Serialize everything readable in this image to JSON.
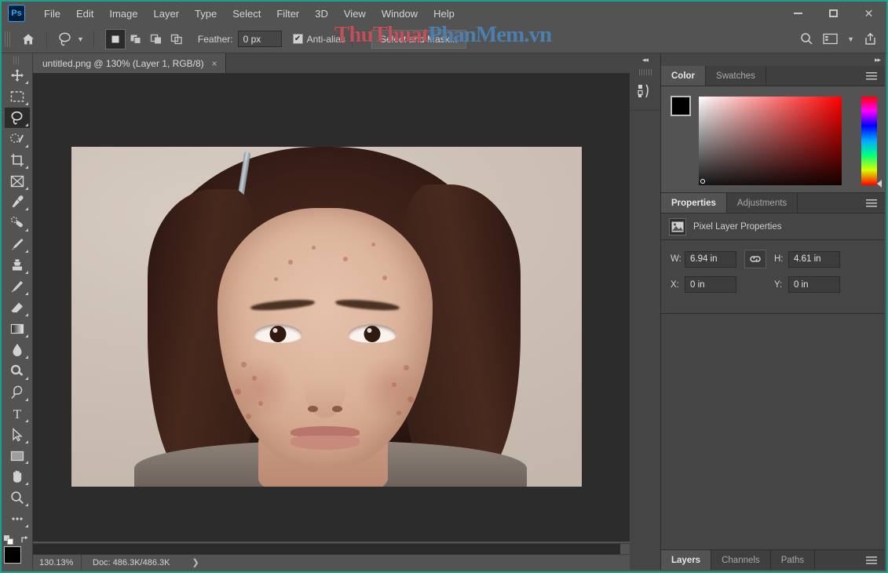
{
  "window": {
    "app_logo": "Ps",
    "minimize": "minimize-button",
    "maximize": "maximize-button",
    "close": "✕"
  },
  "menubar": {
    "items": [
      {
        "label": "File"
      },
      {
        "label": "Edit"
      },
      {
        "label": "Image"
      },
      {
        "label": "Layer"
      },
      {
        "label": "Type"
      },
      {
        "label": "Select"
      },
      {
        "label": "Filter"
      },
      {
        "label": "3D"
      },
      {
        "label": "View"
      },
      {
        "label": "Window"
      },
      {
        "label": "Help"
      }
    ]
  },
  "options_bar": {
    "tool_name": "lasso-tool",
    "selection_modes": [
      "new-selection",
      "add-to-selection",
      "subtract-from-selection",
      "intersect-with-selection"
    ],
    "active_selection_mode": 0,
    "feather_label": "Feather:",
    "feather_value": "0 px",
    "feather_placeholder": "0 px",
    "antialias_label": "Anti-alias",
    "antialias_checked": true,
    "antialias_mark": "✔",
    "select_and_mask_label": "Select and Mask...",
    "right_icons": [
      "search-icon",
      "workspace-icon",
      "share-icon"
    ]
  },
  "watermark": {
    "part_a": "ThuThuat",
    "part_b": "PhanMem.vn",
    "color_a": "#c0505a",
    "color_b": "#4c7fae"
  },
  "toolbar": {
    "tools": [
      {
        "name": "move-tool"
      },
      {
        "name": "rectangular-marquee-tool"
      },
      {
        "name": "lasso-tool",
        "active": true
      },
      {
        "name": "quick-selection-tool"
      },
      {
        "name": "crop-tool"
      },
      {
        "name": "frame-tool"
      },
      {
        "name": "eyedropper-tool"
      },
      {
        "name": "spot-healing-brush-tool"
      },
      {
        "name": "brush-tool"
      },
      {
        "name": "clone-stamp-tool"
      },
      {
        "name": "history-brush-tool"
      },
      {
        "name": "eraser-tool"
      },
      {
        "name": "gradient-tool"
      },
      {
        "name": "blur-tool"
      },
      {
        "name": "dodge-tool"
      },
      {
        "name": "pen-tool"
      },
      {
        "name": "type-tool"
      },
      {
        "name": "path-selection-tool"
      },
      {
        "name": "rectangle-tool"
      },
      {
        "name": "hand-tool"
      },
      {
        "name": "zoom-tool"
      },
      {
        "name": "edit-toolbar-tool"
      }
    ],
    "foreground_color": "#000000",
    "background_color": "#ffffff"
  },
  "document": {
    "tab_title": "untitled.png @ 130% (Layer 1, RGB/8)",
    "tab_close": "×"
  },
  "status_bar": {
    "zoom": "130.13%",
    "doc_info": "Doc: 486.3K/486.3K",
    "arrow": "❯"
  },
  "middock": {
    "collapse_arrows": "◂◂",
    "icons": [
      "libraries-icon"
    ]
  },
  "right_panels": {
    "expand_arrows": "▸▸",
    "color_panel": {
      "tabs": [
        {
          "label": "Color",
          "active": true
        },
        {
          "label": "Swatches",
          "active": false
        }
      ],
      "menu": "panel-menu-icon",
      "foreground": "#000000",
      "background": "#ffffff",
      "hue_base": "#ff0000"
    },
    "properties_panel": {
      "tabs": [
        {
          "label": "Properties",
          "active": true
        },
        {
          "label": "Adjustments",
          "active": false
        }
      ],
      "menu": "panel-menu-icon",
      "header_title": "Pixel Layer Properties",
      "fields": {
        "w_label": "W:",
        "w_value": "6.94 in",
        "h_label": "H:",
        "h_value": "4.61 in",
        "x_label": "X:",
        "x_value": "0 in",
        "y_label": "Y:",
        "y_value": "0 in",
        "link_icon": "link-icon"
      }
    },
    "layers_panel": {
      "tabs": [
        {
          "label": "Layers",
          "active": true
        },
        {
          "label": "Channels",
          "active": false
        },
        {
          "label": "Paths",
          "active": false
        }
      ],
      "menu": "panel-menu-icon"
    }
  },
  "canvas": {
    "image_description": "portrait-photo",
    "background_color": "#cfc3b7"
  }
}
